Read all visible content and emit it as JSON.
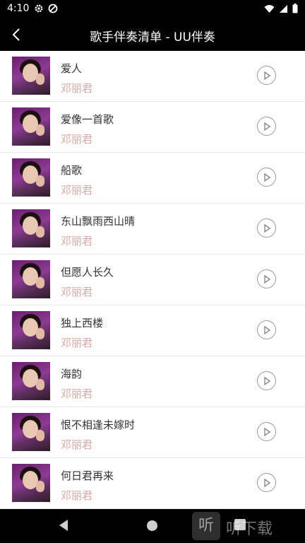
{
  "status_bar": {
    "time": "4:10",
    "left_icons": [
      "gear-icon",
      "no-disturb-icon"
    ],
    "right_icons": [
      "wifi-icon",
      "signal-icon",
      "battery-icon"
    ]
  },
  "app_bar": {
    "back_icon": "chevron-left-icon",
    "title": "歌手伴奏清单 - UU伴奏"
  },
  "songs": [
    {
      "title": "爱人",
      "artist": "邓丽君"
    },
    {
      "title": "爱像一首歌",
      "artist": "邓丽君"
    },
    {
      "title": "船歌",
      "artist": "邓丽君"
    },
    {
      "title": "东山飘雨西山晴",
      "artist": "邓丽君"
    },
    {
      "title": "但愿人长久",
      "artist": "邓丽君"
    },
    {
      "title": "独上西楼",
      "artist": "邓丽君"
    },
    {
      "title": "海韵",
      "artist": "邓丽君"
    },
    {
      "title": "恨不相逢未嫁时",
      "artist": "邓丽君"
    },
    {
      "title": "何日君再来",
      "artist": "邓丽君"
    }
  ],
  "nav_bar": {
    "icons": [
      "nav-back-icon",
      "nav-home-icon",
      "nav-recent-icon"
    ]
  },
  "watermark": {
    "logo_char": "听",
    "text": "听下载"
  },
  "colors": {
    "artist_text": "#d6a8a8",
    "title_text": "#333333",
    "bar_bg": "#000000"
  }
}
